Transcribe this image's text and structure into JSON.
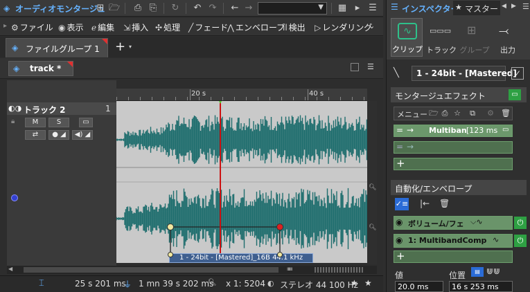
{
  "titlebar": {
    "title": "オーディオモンタージュ"
  },
  "menubar": {
    "items": [
      {
        "label": "ファイル",
        "icon": "gear-icon"
      },
      {
        "label": "表示",
        "icon": "eye-icon"
      },
      {
        "label": "編集",
        "icon": "edit-icon"
      },
      {
        "label": "挿入",
        "icon": "insert-icon"
      },
      {
        "label": "処理",
        "icon": "process-icon"
      },
      {
        "label": "フェード",
        "icon": "fade-icon"
      },
      {
        "label": "エンベロープ",
        "icon": "envelope-icon"
      },
      {
        "label": "検出",
        "icon": "detect-icon"
      },
      {
        "label": "レンダリング",
        "icon": "render-icon"
      }
    ]
  },
  "filetab": {
    "label": "ファイルグループ 1"
  },
  "tracktab": {
    "label": "track *"
  },
  "track": {
    "name": "トラック 2",
    "number": "1",
    "mute": "M",
    "solo": "S"
  },
  "ruler": {
    "labels": [
      "20 s",
      "40 s"
    ]
  },
  "clip": {
    "label": "1 - 24bit - [Mastered]_16B 44.1 kHz"
  },
  "statusbar": {
    "time1": "25 s 201 ms",
    "time2": "1 mn 39 s 202 ms",
    "zoom": "x 1: 5204",
    "format": "ステレオ 44 100 Hz"
  },
  "inspector": {
    "title": "インスペクター",
    "tab2": "マスター",
    "buttons": {
      "clip": "クリップ",
      "track": "トラック",
      "group": "グループ",
      "output": "出力"
    },
    "clip_selector": "1 - 24bit - [Mastered]",
    "montage_fx": {
      "title": "モンタージュエフェクト",
      "menu": "メニュー",
      "plugin1": "Multiban",
      "plugin1_time": "[123 ms"
    },
    "automation": {
      "title": "自動化/エンベロープ",
      "env1": "ボリューム/フェ",
      "env2": "1: MultibandComp"
    },
    "value": {
      "label": "値",
      "value": "20.0 ms"
    },
    "position": {
      "label": "位置",
      "value": "16 s 253 ms"
    }
  },
  "colors": {
    "accent_blue": "#66b3ff",
    "waveform": "#1f6e6e",
    "playhead": "#cc1111",
    "green_active": "#2ea043"
  }
}
